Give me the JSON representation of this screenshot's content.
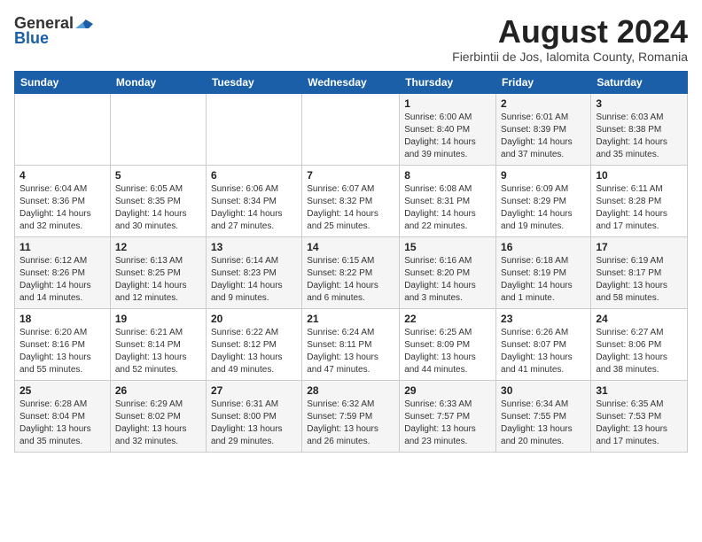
{
  "header": {
    "logo_general": "General",
    "logo_blue": "Blue",
    "month_year": "August 2024",
    "location": "Fierbintii de Jos, Ialomita County, Romania"
  },
  "weekdays": [
    "Sunday",
    "Monday",
    "Tuesday",
    "Wednesday",
    "Thursday",
    "Friday",
    "Saturday"
  ],
  "weeks": [
    [
      {
        "day": "",
        "info": ""
      },
      {
        "day": "",
        "info": ""
      },
      {
        "day": "",
        "info": ""
      },
      {
        "day": "",
        "info": ""
      },
      {
        "day": "1",
        "info": "Sunrise: 6:00 AM\nSunset: 8:40 PM\nDaylight: 14 hours\nand 39 minutes."
      },
      {
        "day": "2",
        "info": "Sunrise: 6:01 AM\nSunset: 8:39 PM\nDaylight: 14 hours\nand 37 minutes."
      },
      {
        "day": "3",
        "info": "Sunrise: 6:03 AM\nSunset: 8:38 PM\nDaylight: 14 hours\nand 35 minutes."
      }
    ],
    [
      {
        "day": "4",
        "info": "Sunrise: 6:04 AM\nSunset: 8:36 PM\nDaylight: 14 hours\nand 32 minutes."
      },
      {
        "day": "5",
        "info": "Sunrise: 6:05 AM\nSunset: 8:35 PM\nDaylight: 14 hours\nand 30 minutes."
      },
      {
        "day": "6",
        "info": "Sunrise: 6:06 AM\nSunset: 8:34 PM\nDaylight: 14 hours\nand 27 minutes."
      },
      {
        "day": "7",
        "info": "Sunrise: 6:07 AM\nSunset: 8:32 PM\nDaylight: 14 hours\nand 25 minutes."
      },
      {
        "day": "8",
        "info": "Sunrise: 6:08 AM\nSunset: 8:31 PM\nDaylight: 14 hours\nand 22 minutes."
      },
      {
        "day": "9",
        "info": "Sunrise: 6:09 AM\nSunset: 8:29 PM\nDaylight: 14 hours\nand 19 minutes."
      },
      {
        "day": "10",
        "info": "Sunrise: 6:11 AM\nSunset: 8:28 PM\nDaylight: 14 hours\nand 17 minutes."
      }
    ],
    [
      {
        "day": "11",
        "info": "Sunrise: 6:12 AM\nSunset: 8:26 PM\nDaylight: 14 hours\nand 14 minutes."
      },
      {
        "day": "12",
        "info": "Sunrise: 6:13 AM\nSunset: 8:25 PM\nDaylight: 14 hours\nand 12 minutes."
      },
      {
        "day": "13",
        "info": "Sunrise: 6:14 AM\nSunset: 8:23 PM\nDaylight: 14 hours\nand 9 minutes."
      },
      {
        "day": "14",
        "info": "Sunrise: 6:15 AM\nSunset: 8:22 PM\nDaylight: 14 hours\nand 6 minutes."
      },
      {
        "day": "15",
        "info": "Sunrise: 6:16 AM\nSunset: 8:20 PM\nDaylight: 14 hours\nand 3 minutes."
      },
      {
        "day": "16",
        "info": "Sunrise: 6:18 AM\nSunset: 8:19 PM\nDaylight: 14 hours\nand 1 minute."
      },
      {
        "day": "17",
        "info": "Sunrise: 6:19 AM\nSunset: 8:17 PM\nDaylight: 13 hours\nand 58 minutes."
      }
    ],
    [
      {
        "day": "18",
        "info": "Sunrise: 6:20 AM\nSunset: 8:16 PM\nDaylight: 13 hours\nand 55 minutes."
      },
      {
        "day": "19",
        "info": "Sunrise: 6:21 AM\nSunset: 8:14 PM\nDaylight: 13 hours\nand 52 minutes."
      },
      {
        "day": "20",
        "info": "Sunrise: 6:22 AM\nSunset: 8:12 PM\nDaylight: 13 hours\nand 49 minutes."
      },
      {
        "day": "21",
        "info": "Sunrise: 6:24 AM\nSunset: 8:11 PM\nDaylight: 13 hours\nand 47 minutes."
      },
      {
        "day": "22",
        "info": "Sunrise: 6:25 AM\nSunset: 8:09 PM\nDaylight: 13 hours\nand 44 minutes."
      },
      {
        "day": "23",
        "info": "Sunrise: 6:26 AM\nSunset: 8:07 PM\nDaylight: 13 hours\nand 41 minutes."
      },
      {
        "day": "24",
        "info": "Sunrise: 6:27 AM\nSunset: 8:06 PM\nDaylight: 13 hours\nand 38 minutes."
      }
    ],
    [
      {
        "day": "25",
        "info": "Sunrise: 6:28 AM\nSunset: 8:04 PM\nDaylight: 13 hours\nand 35 minutes."
      },
      {
        "day": "26",
        "info": "Sunrise: 6:29 AM\nSunset: 8:02 PM\nDaylight: 13 hours\nand 32 minutes."
      },
      {
        "day": "27",
        "info": "Sunrise: 6:31 AM\nSunset: 8:00 PM\nDaylight: 13 hours\nand 29 minutes."
      },
      {
        "day": "28",
        "info": "Sunrise: 6:32 AM\nSunset: 7:59 PM\nDaylight: 13 hours\nand 26 minutes."
      },
      {
        "day": "29",
        "info": "Sunrise: 6:33 AM\nSunset: 7:57 PM\nDaylight: 13 hours\nand 23 minutes."
      },
      {
        "day": "30",
        "info": "Sunrise: 6:34 AM\nSunset: 7:55 PM\nDaylight: 13 hours\nand 20 minutes."
      },
      {
        "day": "31",
        "info": "Sunrise: 6:35 AM\nSunset: 7:53 PM\nDaylight: 13 hours\nand 17 minutes."
      }
    ]
  ]
}
